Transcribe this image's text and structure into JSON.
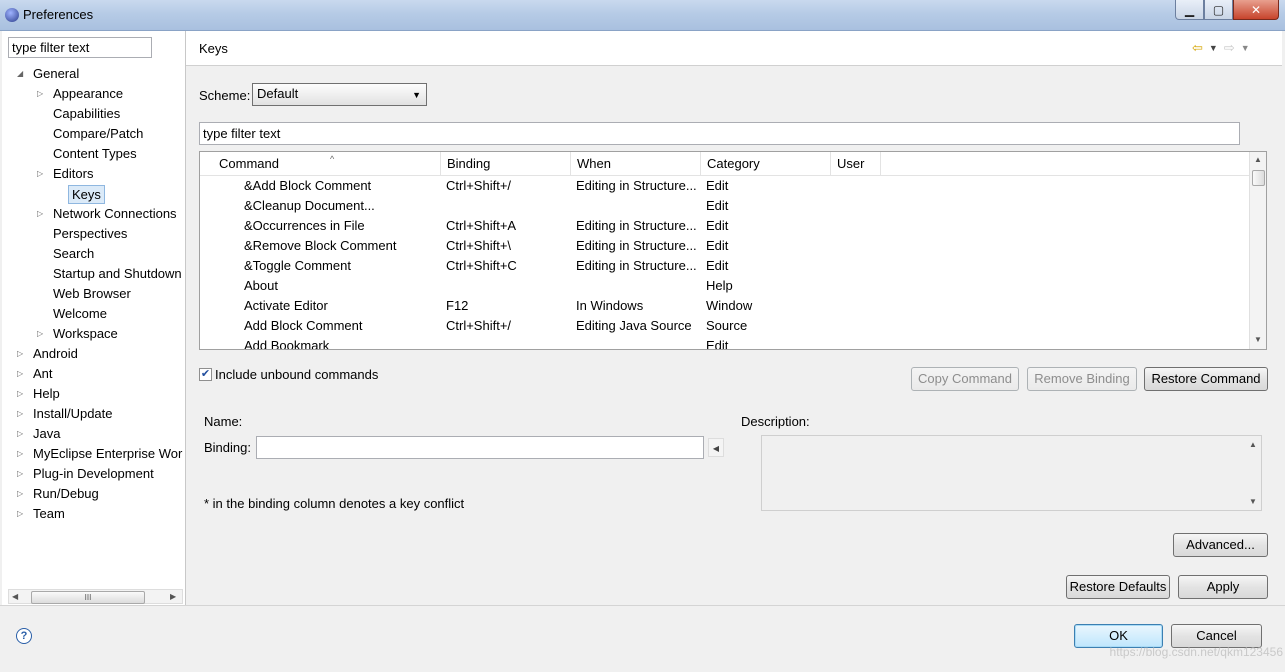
{
  "window": {
    "title": "Preferences",
    "controls": {
      "minimize": "▁",
      "maximize": "▢",
      "close": "✕"
    }
  },
  "left": {
    "filter_value": "type filter text",
    "tree": [
      {
        "label": "General",
        "level": 0,
        "expanded": true
      },
      {
        "label": "Appearance",
        "level": 1,
        "collapsed": true
      },
      {
        "label": "Capabilities",
        "level": 1
      },
      {
        "label": "Compare/Patch",
        "level": 1
      },
      {
        "label": "Content Types",
        "level": 1
      },
      {
        "label": "Editors",
        "level": 1,
        "collapsed": true
      },
      {
        "label": "Keys",
        "level": 1,
        "selected": true
      },
      {
        "label": "Network Connections",
        "level": 1,
        "collapsed": true
      },
      {
        "label": "Perspectives",
        "level": 1
      },
      {
        "label": "Search",
        "level": 1
      },
      {
        "label": "Startup and Shutdown",
        "level": 1
      },
      {
        "label": "Web Browser",
        "level": 1
      },
      {
        "label": "Welcome",
        "level": 1
      },
      {
        "label": "Workspace",
        "level": 1,
        "collapsed": true
      },
      {
        "label": "Android",
        "level": 0,
        "collapsed": true
      },
      {
        "label": "Ant",
        "level": 0,
        "collapsed": true
      },
      {
        "label": "Help",
        "level": 0,
        "collapsed": true
      },
      {
        "label": "Install/Update",
        "level": 0,
        "collapsed": true
      },
      {
        "label": "Java",
        "level": 0,
        "collapsed": true
      },
      {
        "label": "MyEclipse Enterprise Wor",
        "level": 0,
        "collapsed": true
      },
      {
        "label": "Plug-in Development",
        "level": 0,
        "collapsed": true
      },
      {
        "label": "Run/Debug",
        "level": 0,
        "collapsed": true
      },
      {
        "label": "Team",
        "level": 0,
        "collapsed": true
      }
    ],
    "hscroll_thumb": "III"
  },
  "page": {
    "title": "Keys",
    "nav_back": "⇦",
    "nav_forward": "⇨",
    "scheme_label": "Scheme:",
    "scheme_value": "Default",
    "filter_value": "type filter text",
    "columns": [
      "Command",
      "Binding",
      "When",
      "Category",
      "User"
    ],
    "rows": [
      [
        "&Add Block Comment",
        "Ctrl+Shift+/",
        "Editing in Structure...",
        "Edit",
        ""
      ],
      [
        "&Cleanup Document...",
        "",
        "",
        "Edit",
        ""
      ],
      [
        "&Occurrences in File",
        "Ctrl+Shift+A",
        "Editing in Structure...",
        "Edit",
        ""
      ],
      [
        "&Remove Block Comment",
        "Ctrl+Shift+\\",
        "Editing in Structure...",
        "Edit",
        ""
      ],
      [
        "&Toggle Comment",
        "Ctrl+Shift+C",
        "Editing in Structure...",
        "Edit",
        ""
      ],
      [
        "About",
        "",
        "",
        "Help",
        ""
      ],
      [
        "Activate Editor",
        "F12",
        "In Windows",
        "Window",
        ""
      ],
      [
        "Add Block Comment",
        "Ctrl+Shift+/",
        "Editing Java Source",
        "Source",
        ""
      ],
      [
        "Add Bookmark",
        "",
        "",
        "Edit",
        ""
      ]
    ],
    "include_unbound_label": "Include unbound commands",
    "include_unbound_checked": true,
    "copy_command": "Copy Command",
    "remove_binding": "Remove Binding",
    "restore_command": "Restore Command",
    "name_label": "Name:",
    "binding_label": "Binding:",
    "description_label": "Description:",
    "conflict_note": "* in the binding column denotes a key conflict",
    "advanced": "Advanced...",
    "restore_defaults": "Restore Defaults",
    "apply": "Apply"
  },
  "footer": {
    "ok": "OK",
    "cancel": "Cancel",
    "help": "?",
    "watermark": "https://blog.csdn.net/qkm123456"
  }
}
